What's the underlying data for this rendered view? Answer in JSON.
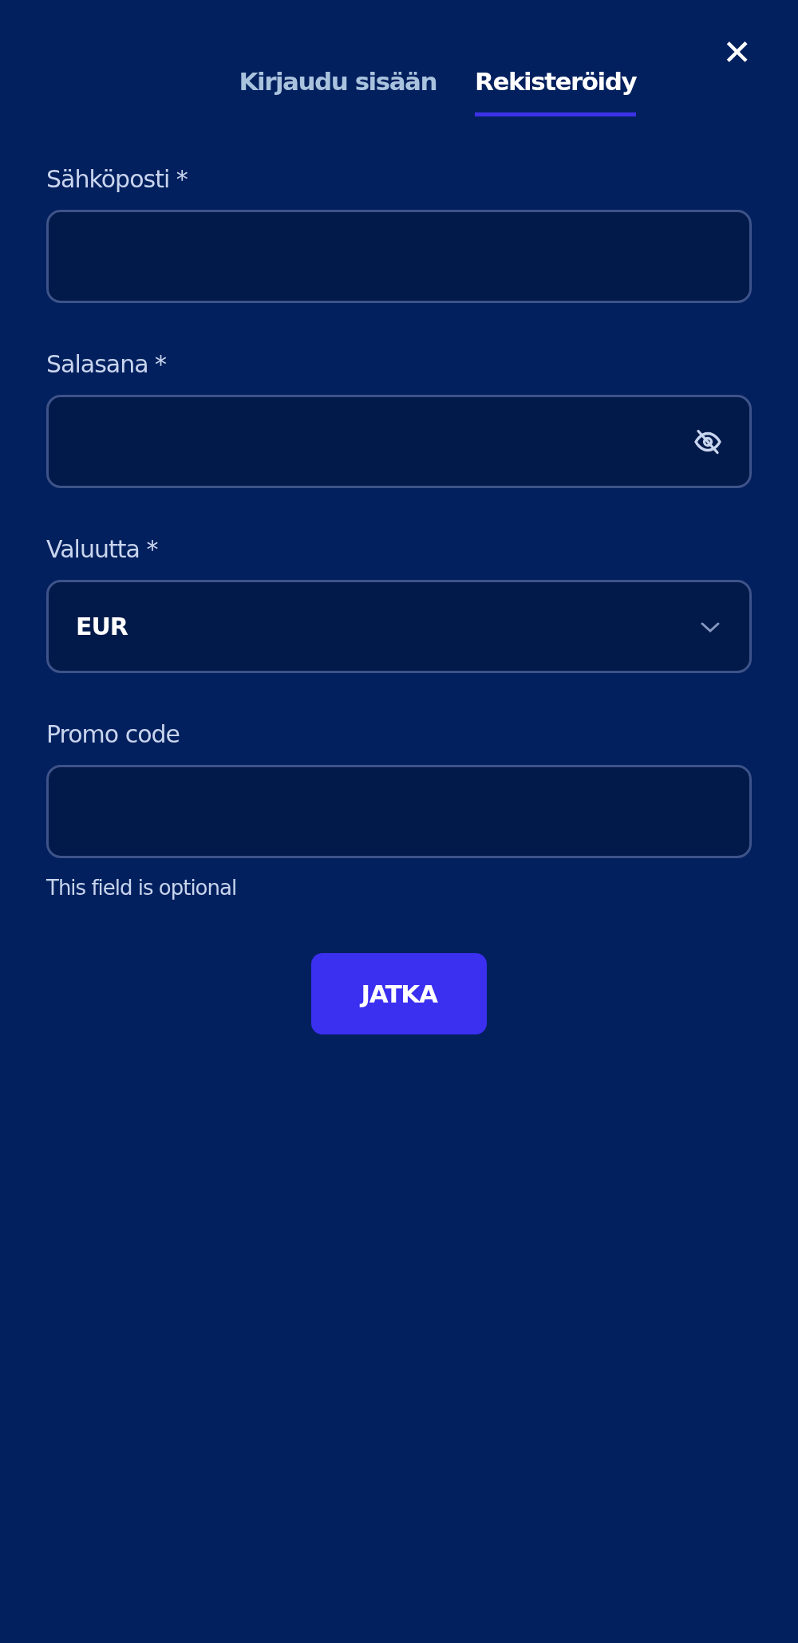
{
  "tabs": [
    {
      "label": "Kirjaudu sisään",
      "selected": false
    },
    {
      "label": "Rekisteröidy",
      "selected": true
    }
  ],
  "close": {
    "label": "✕"
  },
  "fields": [
    {
      "kind": "text",
      "label": "Sähköposti *"
    },
    {
      "kind": "password",
      "label": "Salasana *"
    },
    {
      "kind": "select",
      "label": "Valuutta *",
      "value": "EUR"
    },
    {
      "kind": "text",
      "label": "Promo code",
      "hint": "This field is optional"
    }
  ],
  "submit": {
    "label": "JATKA"
  }
}
